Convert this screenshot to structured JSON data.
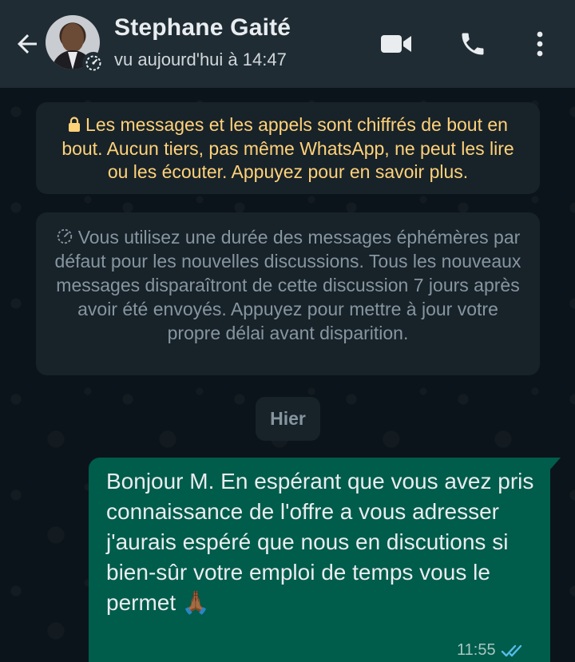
{
  "header": {
    "contact_name": "Stephane Gaité",
    "last_seen": "vu aujourd'hui à 14:47",
    "icons": [
      "back-arrow-icon",
      "video-call-icon",
      "voice-call-icon",
      "more-options-icon"
    ]
  },
  "system_messages": {
    "encryption": "Les messages et les appels sont chiffrés de bout en bout. Aucun tiers, pas même WhatsApp, ne peut les lire ou les écouter. Appuyez pour en savoir plus.",
    "ephemeral": "Vous utilisez une durée des messages éphémères par défaut pour les nouvelles discussions. Tous les nouveaux messages disparaîtront de cette discussion 7 jours après avoir été envoyés. Appuyez pour mettre à jour votre propre délai avant disparition."
  },
  "date_chip": "Hier",
  "messages": [
    {
      "direction": "outgoing",
      "text": "Bonjour M. En espérant que vous avez pris connaissance de l'offre a vous adresser j'aurais espéré que nous en discutions si bien-sûr votre emploi de temps vous le permet 🙏🏾",
      "time": "11:55",
      "status": "read"
    }
  ],
  "colors": {
    "header_bg": "#1f2c34",
    "chat_bg": "#0b141a",
    "system_bg": "#182229",
    "encryption_text": "#ffd279",
    "outgoing_bubble": "#005c4b",
    "read_ticks": "#53bdeb"
  }
}
